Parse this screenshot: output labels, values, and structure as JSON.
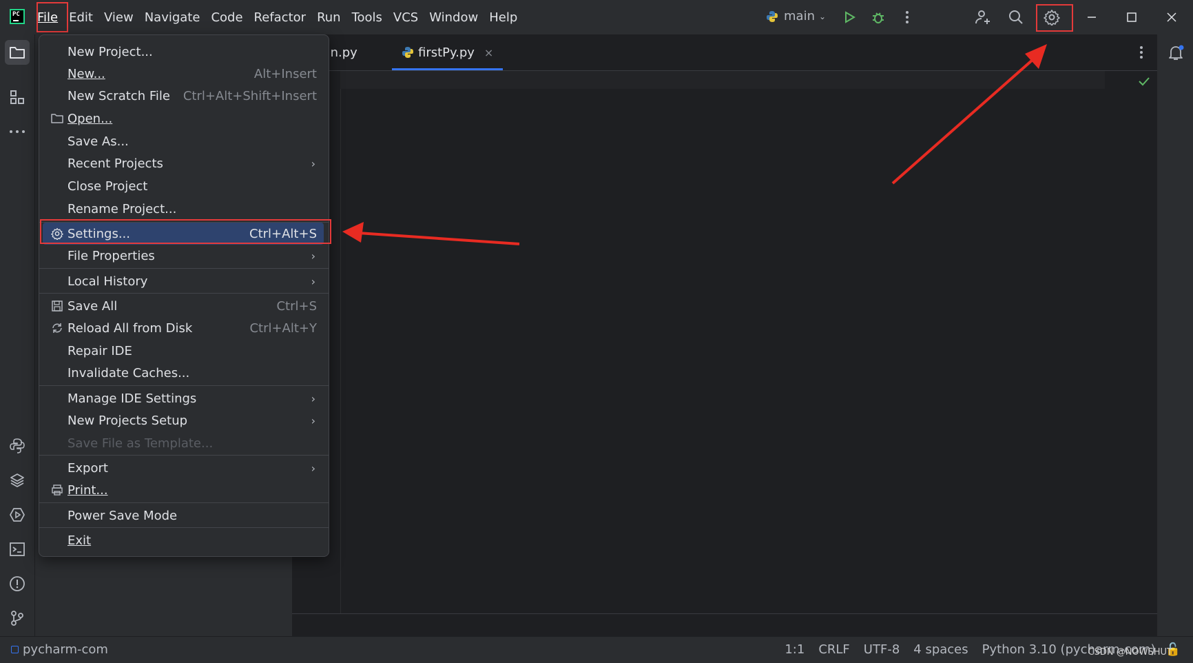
{
  "menubar": {
    "items": [
      {
        "label": "File"
      },
      {
        "label": "Edit"
      },
      {
        "label": "View"
      },
      {
        "label": "Navigate"
      },
      {
        "label": "Code"
      },
      {
        "label": "Refactor"
      },
      {
        "label": "Run"
      },
      {
        "label": "Tools"
      },
      {
        "label": "VCS"
      },
      {
        "label": "Window"
      },
      {
        "label": "Help"
      }
    ]
  },
  "toolbar": {
    "branch": "main",
    "logo_text": "PC"
  },
  "editor": {
    "tabs": [
      {
        "label": "main.py"
      },
      {
        "label": "firstPy.py"
      }
    ]
  },
  "file_menu": {
    "items": [
      {
        "label": "New Project...",
        "shortcut": ""
      },
      {
        "label": "New...",
        "shortcut": "Alt+Insert"
      },
      {
        "label": "New Scratch File",
        "shortcut": "Ctrl+Alt+Shift+Insert"
      },
      {
        "label": "Open...",
        "shortcut": ""
      },
      {
        "label": "Save As...",
        "shortcut": ""
      },
      {
        "label": "Recent Projects",
        "shortcut": ""
      },
      {
        "label": "Close Project",
        "shortcut": ""
      },
      {
        "label": "Rename Project...",
        "shortcut": ""
      },
      {
        "label": "Settings...",
        "shortcut": "Ctrl+Alt+S"
      },
      {
        "label": "File Properties",
        "shortcut": ""
      },
      {
        "label": "Local History",
        "shortcut": ""
      },
      {
        "label": "Save All",
        "shortcut": "Ctrl+S"
      },
      {
        "label": "Reload All from Disk",
        "shortcut": "Ctrl+Alt+Y"
      },
      {
        "label": "Repair IDE",
        "shortcut": ""
      },
      {
        "label": "Invalidate Caches...",
        "shortcut": ""
      },
      {
        "label": "Manage IDE Settings",
        "shortcut": ""
      },
      {
        "label": "New Projects Setup",
        "shortcut": ""
      },
      {
        "label": "Save File as Template...",
        "shortcut": ""
      },
      {
        "label": "Export",
        "shortcut": ""
      },
      {
        "label": "Print...",
        "shortcut": ""
      },
      {
        "label": "Power Save Mode",
        "shortcut": ""
      },
      {
        "label": "Exit",
        "shortcut": ""
      }
    ]
  },
  "statusbar": {
    "project": "pycharm-com",
    "position": "1:1",
    "line_ending": "CRLF",
    "encoding": "UTF-8",
    "indent": "4 spaces",
    "interpreter": "Python 3.10 (pycharm-com)",
    "watermark": "CSDN @NOWSHUT"
  },
  "colors": {
    "highlight": "#e43a3a",
    "selection": "#2e436e",
    "accent": "#3574f0"
  }
}
